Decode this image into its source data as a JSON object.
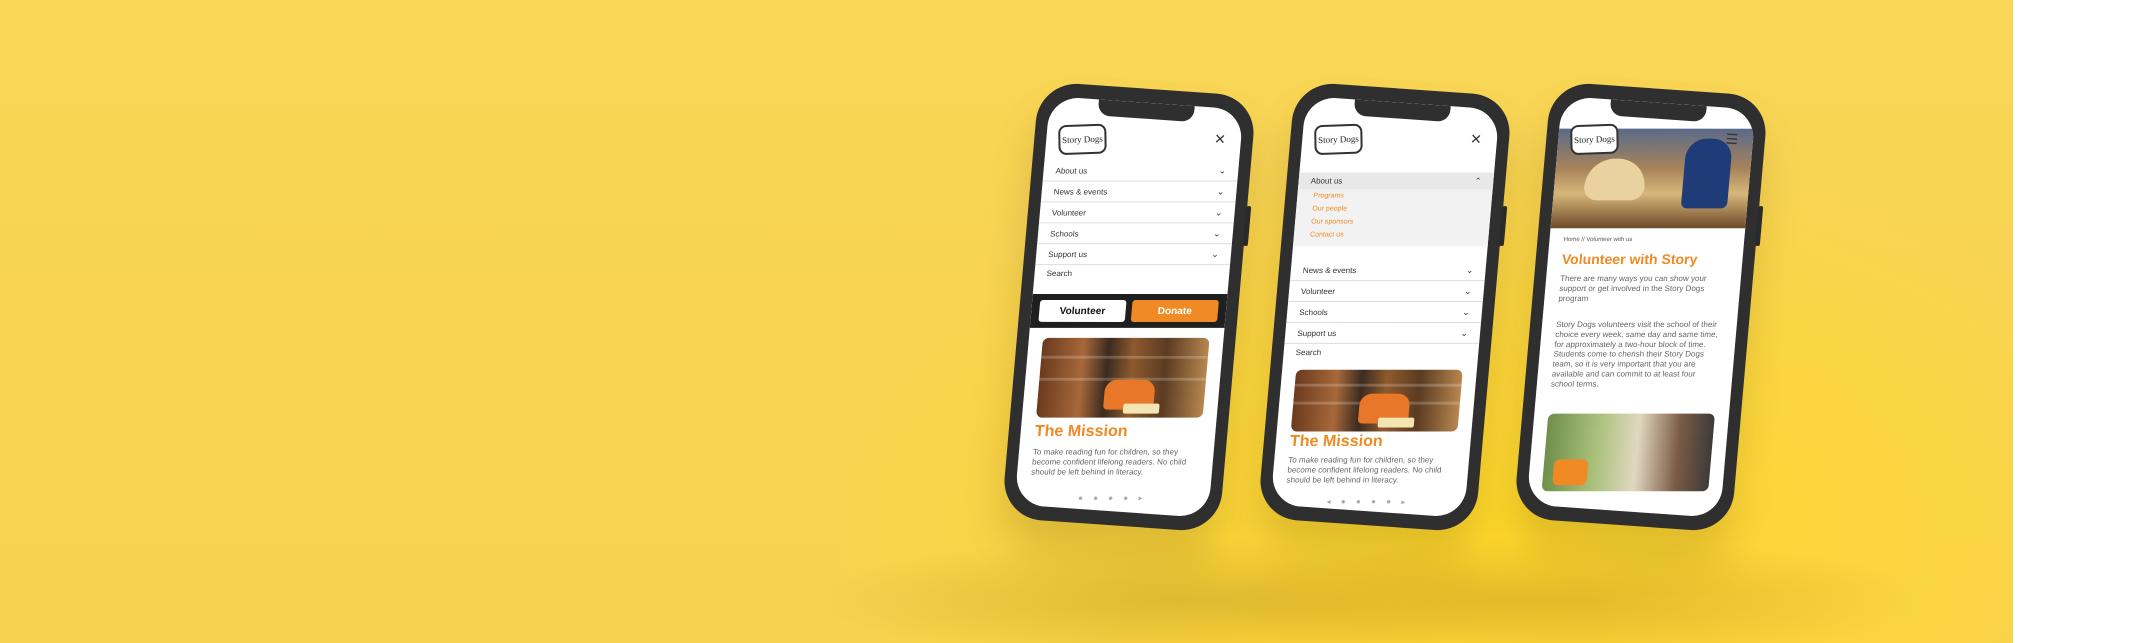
{
  "phone1": {
    "logo": "Story Dogs",
    "menu": [
      "About us",
      "News & events",
      "Volunteer",
      "Schools",
      "Support us"
    ],
    "search": "Search",
    "cta_volunteer": "Volunteer",
    "cta_donate": "Donate",
    "heading": "The Mission",
    "text": "To make reading fun for children, so they become confident lifelong readers. No child should be left behind in literacy."
  },
  "phone2": {
    "logo": "Story Dogs",
    "open_item": "About us",
    "submenu": [
      "Programs",
      "Our people",
      "Our sponsors",
      "Contact us"
    ],
    "menu": [
      "News & events",
      "Volunteer",
      "Schools",
      "Support us"
    ],
    "search": "Search",
    "heading": "The Mission",
    "text": "To make reading fun for children, so they become confident lifelong readers. No child should be left behind in literacy."
  },
  "phone3": {
    "logo": "Story Dogs",
    "breadcrumb_home": "Home",
    "breadcrumb_sep": "//",
    "breadcrumb_current": "Volunteer with us",
    "heading": "Volunteer with Story",
    "intro": "There are many ways you can show your support or get involved in the Story Dogs program",
    "body": "Story Dogs volunteers visit the school of their choice every week, same day and same time, for approximately a two-hour block of time. Students come to cherish their Story Dogs team, so it is very important that you are available and can commit to at least four school terms."
  },
  "colors": {
    "background": "#f9d656",
    "accent": "#f08a24",
    "phone_frame": "#2f2f2f"
  }
}
